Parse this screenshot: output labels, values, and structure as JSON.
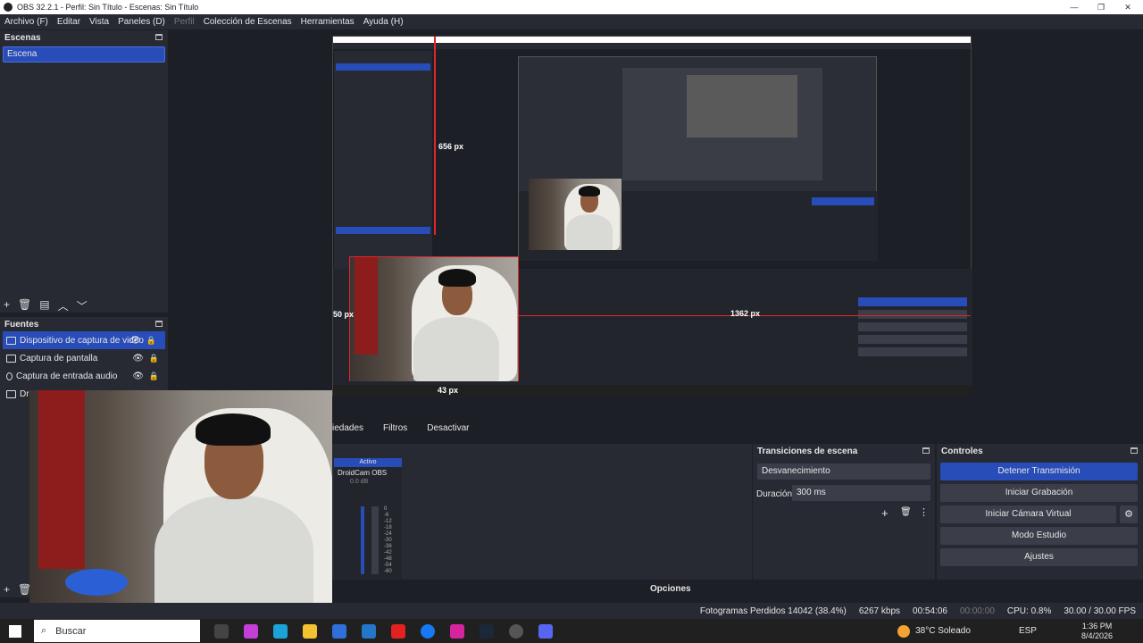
{
  "window": {
    "title": "OBS 32.2.1 - Perfil: Sin Título - Escenas: Sin Título"
  },
  "menu": {
    "items": [
      "Archivo (F)",
      "Editar",
      "Vista",
      "Paneles (D)",
      "Perfil",
      "Colección de Escenas",
      "Herramientas",
      "Ayuda (H)"
    ]
  },
  "scenes": {
    "title": "Escenas",
    "items": [
      "Escena"
    ]
  },
  "sources": {
    "title": "Fuentes",
    "items": [
      "Dispositivo de captura de video",
      "Captura de pantalla",
      "Captura de entrada audio",
      "Dro"
    ]
  },
  "preview": {
    "labels": {
      "height_px": "656 px",
      "width_px": "1362 px",
      "left_px": "50 px",
      "bottom_px": "43 px"
    }
  },
  "tabs": {
    "properties": "iedades",
    "filters": "Filtros",
    "deactivate": "Desactivar"
  },
  "mixer": {
    "active": "Activo",
    "device": "DroidCam OBS",
    "level": "0.0 dB",
    "scale": [
      "0",
      "-6",
      "-12",
      "-18",
      "-24",
      "-30",
      "-36",
      "-42",
      "-48",
      "-54",
      "-60"
    ],
    "options": "Opciones"
  },
  "transitions": {
    "title": "Transiciones de escena",
    "type": "Desvanecimiento",
    "duration_label": "Duración",
    "duration_value": "300 ms"
  },
  "controls": {
    "title": "Controles",
    "stop_stream": "Detener Transmisión",
    "start_record": "Iniciar Grabación",
    "start_virtual_cam": "Iniciar Cámara Virtual",
    "studio_mode": "Modo Estudio",
    "settings": "Ajustes"
  },
  "status": {
    "dropped_frames": "Fotogramas Perdidos 14042 (38.4%)",
    "bitrate": "6267 kbps",
    "stream_time": "00:54:06",
    "record_time": "00:00:00",
    "cpu": "CPU: 0.8%",
    "fps": "30.00 / 30.00 FPS"
  },
  "taskbar": {
    "search_placeholder": "Buscar",
    "weather": "38°C Soleado",
    "lang": "ESP",
    "time": "1:36 PM",
    "date": "8/4/2026"
  },
  "colors": {
    "accent": "#284cb8",
    "red_guide": "#e0262b",
    "panel": "#272a33",
    "background": "#1d1f26"
  }
}
